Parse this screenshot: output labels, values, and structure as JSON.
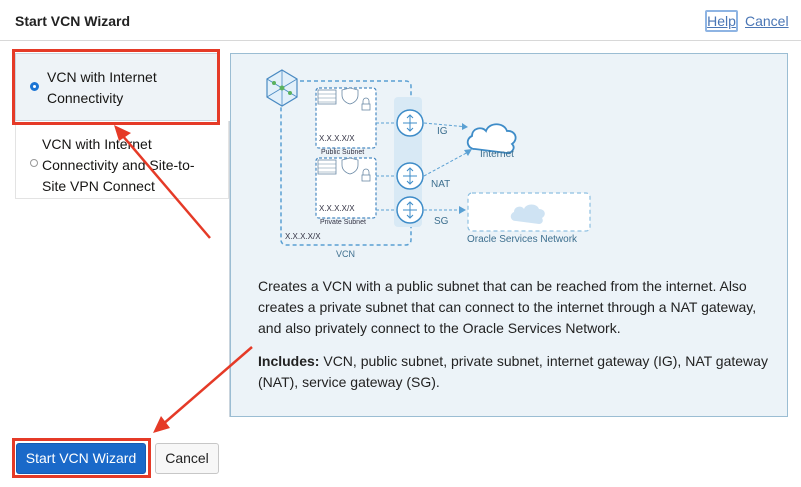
{
  "header": {
    "title": "Start VCN Wizard",
    "help_label": "Help",
    "cancel_label": "Cancel"
  },
  "options": [
    {
      "line1": "VCN with Internet",
      "line2": "Connectivity",
      "selected": true
    },
    {
      "line1": "VCN with Internet",
      "line2": "Connectivity and Site-to-",
      "line3": "Site VPN Connect",
      "selected": false
    }
  ],
  "diagram": {
    "public_subnet": "Public Subnet",
    "private_subnet": "Private Subnet",
    "cidr_public": "X.X.X.X/X",
    "cidr_private": "X.X.X.X/X",
    "cidr_vcn": "X.X.X.X/X",
    "vcn_label": "VCN",
    "ig_label": "IG",
    "nat_label": "NAT",
    "sg_label": "SG",
    "internet_label": "Internet",
    "osn_label": "Oracle Services Network"
  },
  "description": "Creates a VCN with a public subnet that can be reached from the internet. Also creates a private subnet that can connect to the internet through a NAT gateway, and also privately connect to the Oracle Services Network.",
  "includes": {
    "label": "Includes:",
    "text": " VCN, public subnet, private subnet, internet gateway (IG), NAT gateway (NAT), service gateway (SG)."
  },
  "footer": {
    "start_label": "Start VCN Wizard",
    "cancel_label": "Cancel"
  },
  "colors": {
    "primary": "#1a69c9",
    "highlight": "#e53a27",
    "panel_bg": "#ecf3f8",
    "link": "#4a76b5"
  }
}
